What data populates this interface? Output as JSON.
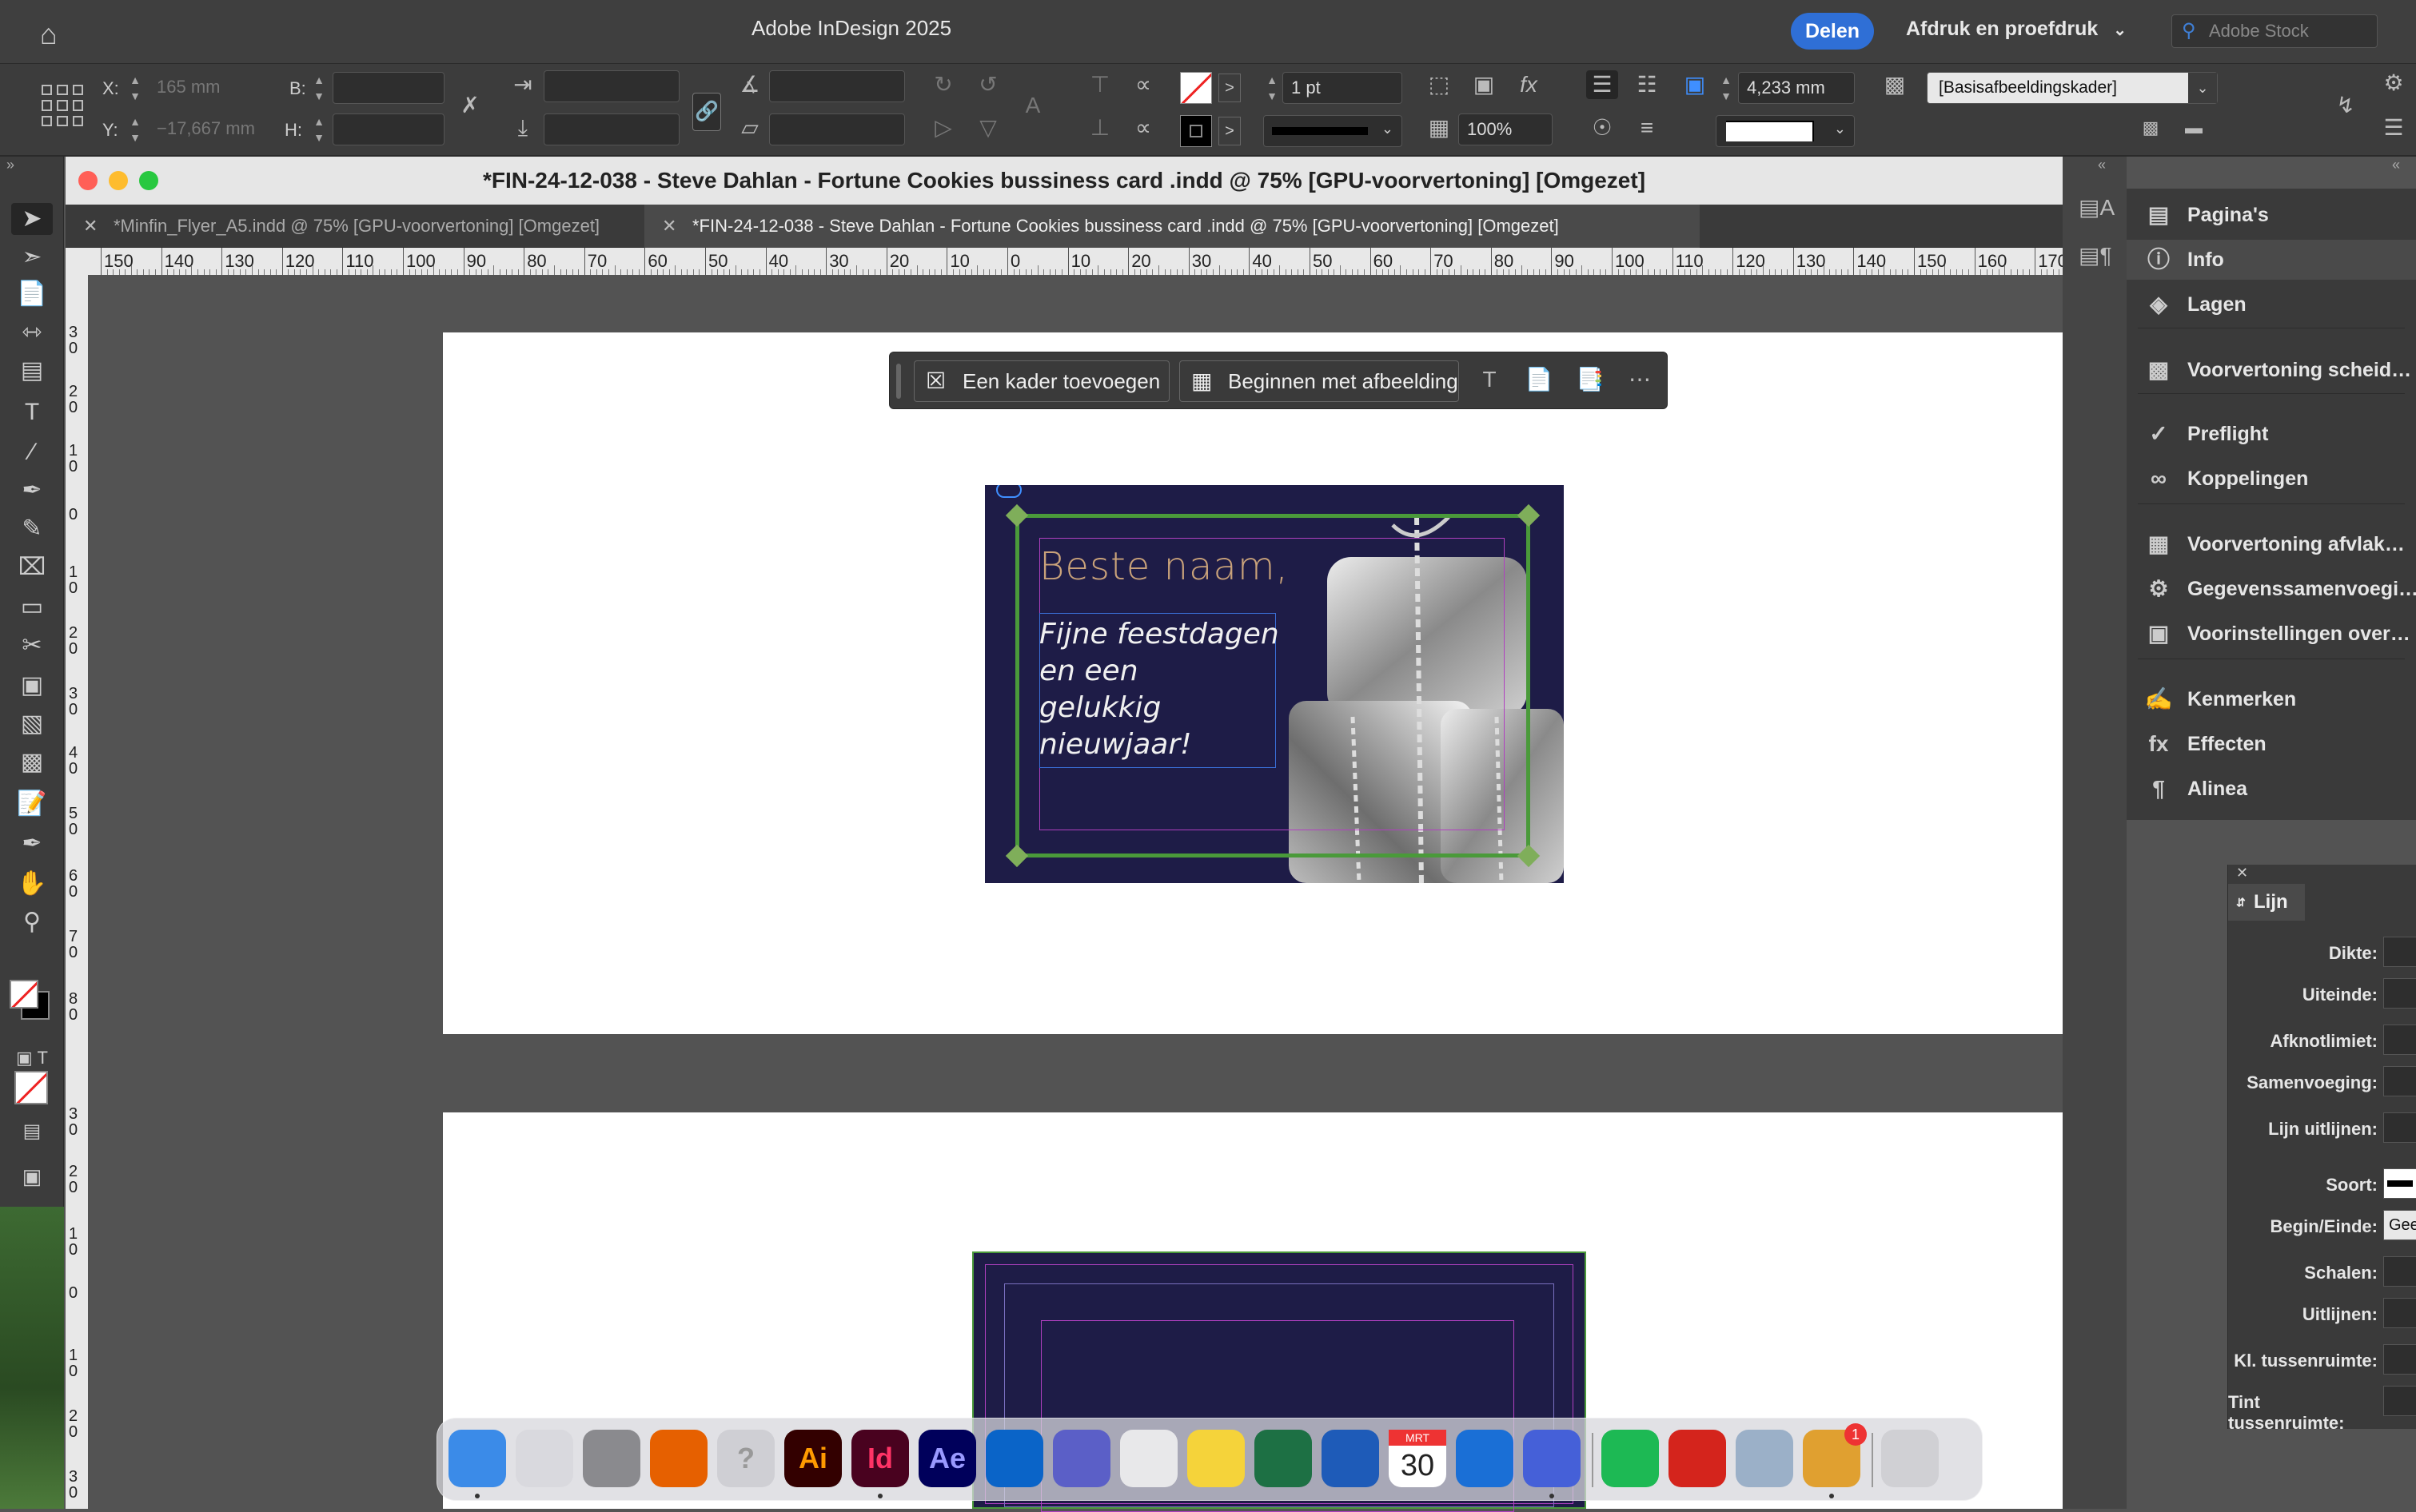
{
  "app": {
    "title": "Adobe InDesign 2025",
    "share_label": "Delen",
    "workspace_label": "Afdruk en proefdruk",
    "stock_placeholder": "Adobe Stock"
  },
  "control": {
    "x_label": "X:",
    "x_value": "165 mm",
    "y_label": "Y:",
    "y_value": "−17,667 mm",
    "b_label": "B:",
    "b_value": "",
    "h_label": "H:",
    "h_value": "",
    "stroke_weight": "1 pt",
    "scale_value": "100%",
    "size_value": "4,233 mm",
    "object_style": "[Basisafbeeldingskader]"
  },
  "window": {
    "title": "*FIN-24-12-038 - Steve Dahlan - Fortune Cookies bussiness card .indd @ 75% [GPU-voorvertoning] [Omgezet]"
  },
  "tabs": [
    {
      "label": "*Minfin_Flyer_A5.indd @ 75% [GPU-voorvertoning] [Omgezet]"
    },
    {
      "label": "*FIN-24-12-038 - Steve Dahlan - Fortune Cookies bussiness card .indd @ 75% [GPU-voorvertoning] [Omgezet]"
    }
  ],
  "ruler_h": [
    "150",
    "140",
    "130",
    "120",
    "110",
    "100",
    "90",
    "80",
    "70",
    "60",
    "50",
    "40",
    "30",
    "20",
    "10",
    "0",
    "10",
    "20",
    "30",
    "40",
    "50",
    "60",
    "70",
    "80",
    "90",
    "100",
    "110",
    "120",
    "130",
    "140",
    "150",
    "160",
    "170"
  ],
  "ruler_v": [
    "3\n0",
    "2\n0",
    "1\n0",
    "0",
    "1\n0",
    "2\n0",
    "3\n0",
    "4\n0",
    "5\n0",
    "6\n0",
    "7\n0",
    "8\n0",
    "3\n0",
    "2\n0",
    "1\n0",
    "0",
    "1\n0",
    "2\n0",
    "3\n0"
  ],
  "contextbar": {
    "add_frame": "Een kader toevoegen",
    "start_image": "Beginnen met afbeelding"
  },
  "card": {
    "greeting": "Beste naam,",
    "message_lines": [
      "Fijne feestdagen",
      "en een",
      "gelukkig",
      "nieuwjaar!"
    ]
  },
  "panels": [
    {
      "label": "Pagina's",
      "icon": "pages-icon"
    },
    {
      "label": "Info",
      "icon": "info-icon"
    },
    {
      "label": "Lagen",
      "icon": "layers-icon"
    },
    {
      "label": "Voorvertoning scheid…",
      "icon": "separations-icon"
    },
    {
      "label": "Preflight",
      "icon": "preflight-icon"
    },
    {
      "label": "Koppelingen",
      "icon": "links-icon"
    },
    {
      "label": "Voorvertoning afvlak…",
      "icon": "flattener-icon"
    },
    {
      "label": "Gegevenssamenvoegi…",
      "icon": "data-merge-icon"
    },
    {
      "label": "Voorinstellingen over…",
      "icon": "presets-icon"
    },
    {
      "label": "Kenmerken",
      "icon": "attributes-icon"
    },
    {
      "label": "Effecten",
      "icon": "effects-icon"
    },
    {
      "label": "Alinea",
      "icon": "paragraph-icon"
    }
  ],
  "lijn": {
    "title": "Lijn",
    "rows": [
      "Dikte:",
      "Uiteinde:",
      "Afknotlimiet:",
      "Samenvoeging:",
      "Lijn uitlijnen:",
      "Soort:",
      "Begin/Einde:",
      "Schalen:",
      "Uitlijnen:",
      "Kl. tussenruimte:",
      "Tint tussenruimte:"
    ],
    "begin_end_value": "Gee"
  },
  "dock": {
    "apps": [
      {
        "name": "finder-icon",
        "label": "",
        "color": "#3b8be8"
      },
      {
        "name": "launchpad-icon",
        "label": "",
        "color": "#d9d9de"
      },
      {
        "name": "system-settings-icon",
        "label": "",
        "color": "#8a8a8e"
      },
      {
        "name": "firefox-icon",
        "label": "",
        "color": "#e66000"
      },
      {
        "name": "unknown-app-icon",
        "label": "?",
        "color": "#cfcfd4"
      },
      {
        "name": "illustrator-icon",
        "label": "Ai",
        "color": "#330000"
      },
      {
        "name": "indesign-icon",
        "label": "Id",
        "color": "#49021f"
      },
      {
        "name": "after-effects-icon",
        "label": "Ae",
        "color": "#00005b"
      },
      {
        "name": "outlook-icon",
        "label": "",
        "color": "#0a64c8"
      },
      {
        "name": "teams-icon",
        "label": "",
        "color": "#5b5fc7"
      },
      {
        "name": "chrome-icon",
        "label": "",
        "color": "#e8e8ea"
      },
      {
        "name": "notes-icon",
        "label": "",
        "color": "#f5d33a"
      },
      {
        "name": "excel-icon",
        "label": "",
        "color": "#1d7044"
      },
      {
        "name": "word-icon",
        "label": "",
        "color": "#1e5bb8"
      },
      {
        "name": "calendar-icon",
        "label": "30",
        "month": "MRT",
        "color": "#ffffff"
      },
      {
        "name": "password-manager-icon",
        "label": "",
        "color": "#1a6fd6"
      },
      {
        "name": "sync-app-icon",
        "label": "",
        "color": "#4560d8"
      },
      {
        "name": "spotify-icon",
        "label": "",
        "color": "#1db954"
      },
      {
        "name": "acrobat-icon",
        "label": "",
        "color": "#d4241c"
      },
      {
        "name": "preview-icon",
        "label": "",
        "color": "#9bb0c8"
      },
      {
        "name": "app-store-updates-icon",
        "label": "",
        "badge": "1",
        "color": "#e0a030"
      },
      {
        "name": "trash-icon",
        "label": "",
        "color": "#d0d0d4"
      }
    ]
  },
  "colors": {
    "accent": "#2f6fd6",
    "card_bg": "#1e1c47",
    "frame_green": "#4a9a3a",
    "greeting_color": "#c9a27a"
  }
}
